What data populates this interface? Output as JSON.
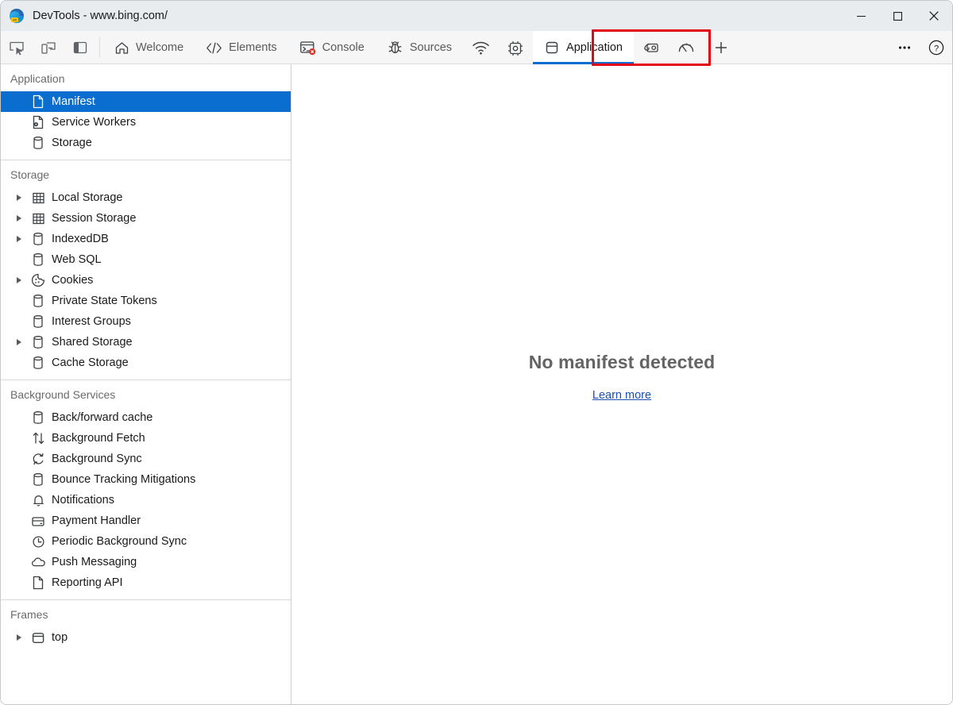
{
  "window": {
    "title": "DevTools - www.bing.com/",
    "logo_icon": "edge-devtools-logo",
    "controls": [
      {
        "name": "minimize-button",
        "icon": "minimize-icon"
      },
      {
        "name": "maximize-button",
        "icon": "maximize-icon"
      },
      {
        "name": "close-button",
        "icon": "close-icon"
      }
    ]
  },
  "toolbar": {
    "left_tools": [
      {
        "name": "inspect-element-button",
        "icon": "inspect-cursor-icon"
      },
      {
        "name": "device-toolbar-button",
        "icon": "device-emulation-icon"
      },
      {
        "name": "dock-side-button",
        "icon": "dock-panel-icon"
      }
    ],
    "tabs": [
      {
        "label": "Welcome",
        "icon": "home-icon",
        "selected": false
      },
      {
        "label": "Elements",
        "icon": "code-brackets-icon",
        "selected": false
      },
      {
        "label": "Console",
        "icon": "console-error-icon",
        "selected": false
      },
      {
        "label": "Sources",
        "icon": "bug-icon",
        "selected": false
      },
      {
        "label": "Network",
        "icon": "wifi-icon",
        "selected": false,
        "icon_only": true
      },
      {
        "label": "Performance",
        "icon": "cpu-chip-icon",
        "selected": false,
        "icon_only": true
      },
      {
        "label": "Application",
        "icon": "application-storage-icon",
        "selected": true
      },
      {
        "label": "Memory",
        "icon": "memory-icon",
        "selected": false,
        "icon_only": true
      },
      {
        "label": "Lighthouse",
        "icon": "gauge-icon",
        "selected": false,
        "icon_only": true
      }
    ],
    "add_tab": {
      "name": "add-panel-button",
      "icon": "plus-icon"
    },
    "right_tools": [
      {
        "name": "more-tools-button",
        "icon": "ellipsis-icon"
      },
      {
        "name": "help-button",
        "icon": "question-mark-icon"
      }
    ],
    "annotation": {
      "target": "Application",
      "color": "#e30613"
    },
    "accent_color": "#0a6ed1"
  },
  "sidebar": {
    "sections": [
      {
        "title": "Application",
        "items": [
          {
            "label": "Manifest",
            "icon": "document-icon",
            "expandable": false,
            "selected": true
          },
          {
            "label": "Service Workers",
            "icon": "service-worker-icon",
            "expandable": false,
            "selected": false
          },
          {
            "label": "Storage",
            "icon": "database-icon",
            "expandable": false,
            "selected": false
          }
        ]
      },
      {
        "title": "Storage",
        "items": [
          {
            "label": "Local Storage",
            "icon": "table-grid-icon",
            "expandable": true,
            "selected": false
          },
          {
            "label": "Session Storage",
            "icon": "table-grid-icon",
            "expandable": true,
            "selected": false
          },
          {
            "label": "IndexedDB",
            "icon": "database-icon",
            "expandable": true,
            "selected": false
          },
          {
            "label": "Web SQL",
            "icon": "database-icon",
            "expandable": false,
            "selected": false
          },
          {
            "label": "Cookies",
            "icon": "cookie-icon",
            "expandable": true,
            "selected": false
          },
          {
            "label": "Private State Tokens",
            "icon": "database-icon",
            "expandable": false,
            "selected": false
          },
          {
            "label": "Interest Groups",
            "icon": "database-icon",
            "expandable": false,
            "selected": false
          },
          {
            "label": "Shared Storage",
            "icon": "database-icon",
            "expandable": true,
            "selected": false
          },
          {
            "label": "Cache Storage",
            "icon": "database-icon",
            "expandable": false,
            "selected": false
          }
        ]
      },
      {
        "title": "Background Services",
        "items": [
          {
            "label": "Back/forward cache",
            "icon": "database-icon",
            "expandable": false,
            "selected": false
          },
          {
            "label": "Background Fetch",
            "icon": "arrows-up-down-icon",
            "expandable": false,
            "selected": false
          },
          {
            "label": "Background Sync",
            "icon": "sync-circle-icon",
            "expandable": false,
            "selected": false
          },
          {
            "label": "Bounce Tracking Mitigations",
            "icon": "database-icon",
            "expandable": false,
            "selected": false
          },
          {
            "label": "Notifications",
            "icon": "bell-icon",
            "expandable": false,
            "selected": false
          },
          {
            "label": "Payment Handler",
            "icon": "credit-card-icon",
            "expandable": false,
            "selected": false
          },
          {
            "label": "Periodic Background Sync",
            "icon": "clock-icon",
            "expandable": false,
            "selected": false
          },
          {
            "label": "Push Messaging",
            "icon": "cloud-icon",
            "expandable": false,
            "selected": false
          },
          {
            "label": "Reporting API",
            "icon": "document-icon",
            "expandable": false,
            "selected": false
          }
        ]
      },
      {
        "title": "Frames",
        "items": [
          {
            "label": "top",
            "icon": "frame-window-icon",
            "expandable": true,
            "selected": false
          }
        ]
      }
    ]
  },
  "main": {
    "empty_title": "No manifest detected",
    "learn_more": "Learn more"
  }
}
